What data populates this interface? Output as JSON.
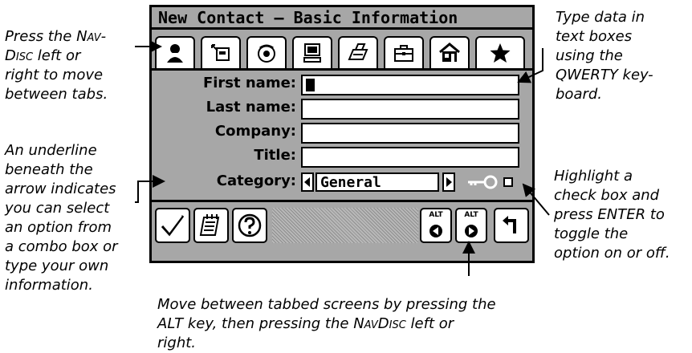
{
  "device": {
    "title": "New Contact — Basic Information",
    "tabs": [
      {
        "icon": "person-icon"
      },
      {
        "icon": "phone-card-icon"
      },
      {
        "icon": "telephone-icon"
      },
      {
        "icon": "computer-icon"
      },
      {
        "icon": "fax-icon"
      },
      {
        "icon": "briefcase-icon"
      },
      {
        "icon": "house-icon"
      },
      {
        "icon": "star-icon"
      }
    ],
    "fields": {
      "first_name_label": "First name:",
      "last_name_label": "Last name:",
      "company_label": "Company:",
      "title_label": "Title:",
      "category_label": "Category:",
      "category_value": "General"
    },
    "buttons": {
      "alt_left": "ALT",
      "alt_right": "ALT"
    }
  },
  "callouts": {
    "nav_disc_1": "Press the ",
    "nav_disc_2": "Nav-",
    "nav_disc_3": "Disc",
    "nav_disc_4": " left or\nright to move\nbetween tabs.",
    "type_data": "Type data in\ntext boxes\nusing the\nQWERTY key-\nboard.",
    "underline": "An underline\nbeneath the\narrow indicates\nyou can select\nan option from\na combo box or\ntype your own\ninformation.",
    "checkbox": "Highlight a\ncheck box and\npress ENTER to\ntoggle the\noption on or off.",
    "alt_key_1": "Move between tabbed screens by pressing the\nALT key, then pressing the ",
    "alt_key_2": "NavDisc",
    "alt_key_3": " left or\nright."
  }
}
